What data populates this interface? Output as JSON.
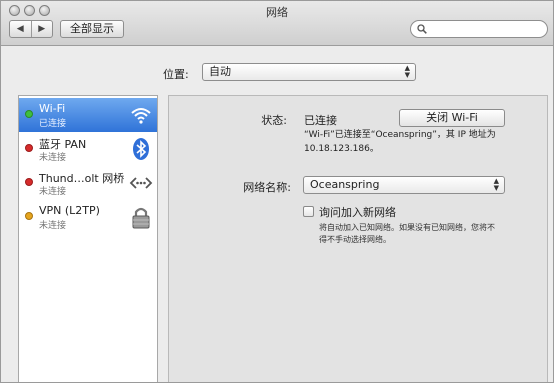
{
  "window": {
    "title": "网络"
  },
  "toolbar": {
    "back_glyph": "◀",
    "forward_glyph": "▶",
    "show_all_label": "全部显示",
    "search_placeholder": ""
  },
  "location": {
    "label": "位置:",
    "value": "自动"
  },
  "services": [
    {
      "name": "Wi-Fi",
      "status": "已连接",
      "dot_color": "#3fbf3f",
      "icon": "wifi-icon",
      "selected": true
    },
    {
      "name": "蓝牙 PAN",
      "status": "未连接",
      "dot_color": "#d62b2b",
      "icon": "bluetooth-icon",
      "selected": false
    },
    {
      "name": "Thund…olt 网桥",
      "status": "未连接",
      "dot_color": "#d62b2b",
      "icon": "thunderbolt-bridge-icon",
      "selected": false
    },
    {
      "name": "VPN (L2TP)",
      "status": "未连接",
      "dot_color": "#e6a51e",
      "icon": "lock-icon",
      "selected": false
    }
  ],
  "detail": {
    "status_label": "状态:",
    "status_value": "已连接",
    "turn_off_label": "关闭 Wi-Fi",
    "status_desc_line1": "“Wi-Fi”已连接至“Oceanspring”，其 IP 地址为",
    "status_desc_line2": "10.18.123.186。",
    "network_name_label": "网络名称:",
    "network_name_value": "Oceanspring",
    "ask_join_label": "询问加入新网络",
    "ask_join_checked": false,
    "ask_join_desc_line1": "将自动加入已知网络。如果没有已知网络，您将不",
    "ask_join_desc_line2": "得不手动选择网络。"
  },
  "colors": {
    "selection": "#3a7ee0",
    "accent_blue": "#2f73d8"
  }
}
